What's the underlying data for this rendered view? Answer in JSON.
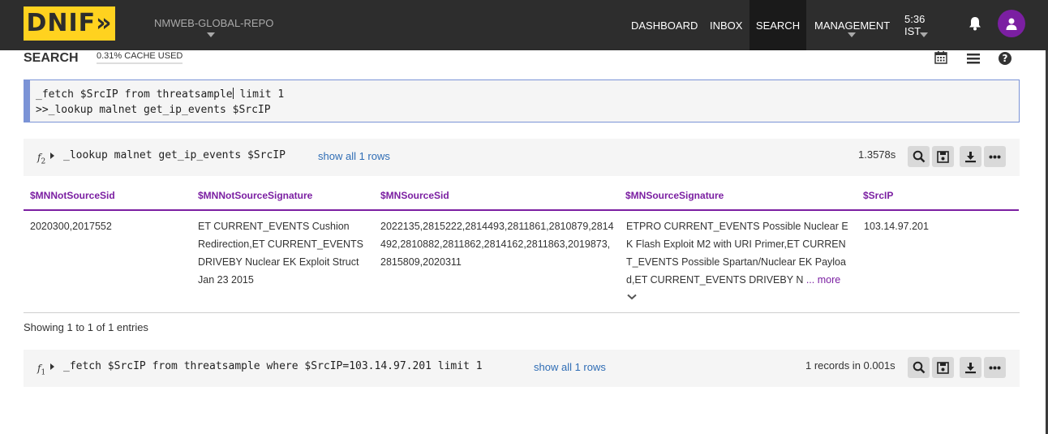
{
  "topbar": {
    "logo_text": "DNIF»",
    "repo_name": "NMWEB-GLOBAL-REPO",
    "nav": [
      {
        "label": "DASHBOARD"
      },
      {
        "label": "INBOX"
      },
      {
        "label": "SEARCH"
      },
      {
        "label": "MANAGEMENT"
      },
      {
        "label": "5:36 IST"
      }
    ],
    "icons": {
      "notifications": "bell-icon",
      "user": "user-icon"
    },
    "colors": {
      "bar": "#2d2d2d",
      "logo": "#ffd21f",
      "avatar": "#7b1fa2"
    }
  },
  "header": {
    "title": "SEARCH",
    "cache_used": "0.31% CACHE USED",
    "icons": [
      "calendar-icon",
      "list-icon",
      "help-icon"
    ]
  },
  "editor": {
    "line1": "_fetch $SrcIP from threatsample",
    "line1_rest": " limit 1",
    "line2": ">>_lookup malnet get_ip_events $SrcIP"
  },
  "panel2": {
    "fn": "f",
    "fn_index": "2",
    "query": "_lookup malnet get_ip_events $SrcIP",
    "show_all": "show all 1 rows",
    "timing": "1.3578s"
  },
  "table": {
    "columns": [
      "$MNNotSourceSid",
      "$MNNotSourceSignature",
      "$MNSourceSid",
      "$MNSourceSignature",
      "$SrcIP"
    ],
    "rows": [
      {
        "not_source_sid": "2020300,2017552",
        "not_source_signature": "ET CURRENT_EVENTS Cushion Redirection,ET CURRENT_EVENTS DRIVEBY Nuclear EK Exploit Struct Jan 23 2015",
        "source_sid": "2022135,2815222,2814493,2811861,2810879,2814492,2810882,2811862,2814162,2811863,2019873,2815809,2020311",
        "source_signature": "ETPRO CURRENT_EVENTS Possible Nuclear EK Flash Exploit M2 with URI Primer,ET CURRENT_EVENTS Possible Spartan/Nuclear EK Payload,ET CURRENT_EVENTS DRIVEBY N",
        "source_signature_more": "... more",
        "src_ip": "103.14.97.201"
      }
    ],
    "entries_info": "Showing 1 to 1 of 1 entries",
    "accent": "#7b1fa2"
  },
  "panel1": {
    "fn": "f",
    "fn_index": "1",
    "query": "_fetch $SrcIP from threatsample where $SrcIP=103.14.97.201 limit 1",
    "show_all": "show all 1 rows",
    "timing": "1 records in 0.001s"
  },
  "panel_buttons": [
    "search-icon",
    "save-icon",
    "download-icon",
    "more-icon"
  ]
}
